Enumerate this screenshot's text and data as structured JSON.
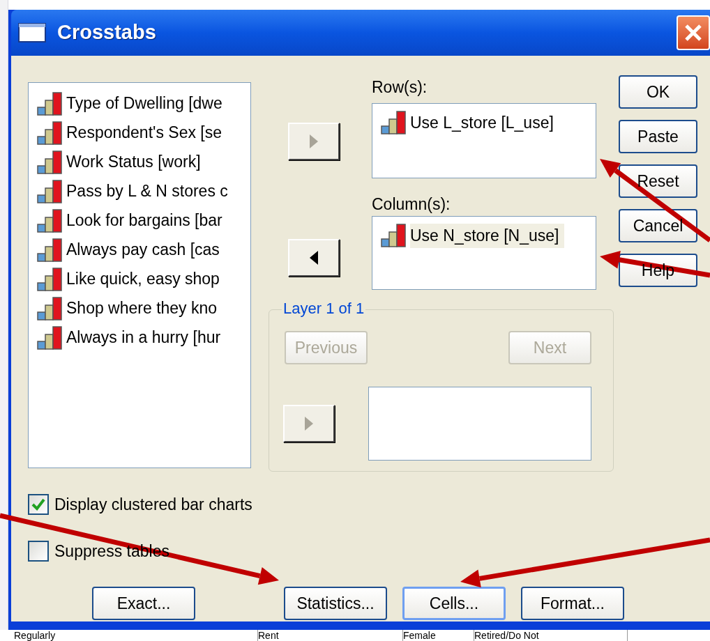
{
  "window": {
    "title": "Crosstabs"
  },
  "variables": [
    {
      "label": "Type of Dwelling [dwe"
    },
    {
      "label": "Respondent's Sex [se"
    },
    {
      "label": "Work Status [work]"
    },
    {
      "label": "Pass by L & N stores c"
    },
    {
      "label": "Look for bargains [bar"
    },
    {
      "label": "Always pay cash [cas"
    },
    {
      "label": "Like quick, easy shop"
    },
    {
      "label": "Shop where they kno"
    },
    {
      "label": "Always in a hurry [hur"
    }
  ],
  "rows": {
    "label": "Row(s):",
    "move_button": {
      "kind": "right",
      "disabled": true
    },
    "items": [
      {
        "label": "Use L_store [L_use]",
        "selected": false
      }
    ]
  },
  "columns": {
    "label": "Column(s):",
    "move_button": {
      "kind": "left",
      "disabled": false
    },
    "items": [
      {
        "label": "Use N_store [N_use]",
        "selected": true
      }
    ]
  },
  "layer": {
    "title": "Layer 1 of 1",
    "previous": {
      "label": "Previous",
      "disabled": true
    },
    "next": {
      "label": "Next",
      "disabled": true
    },
    "move_button": {
      "kind": "right",
      "disabled": true
    }
  },
  "side_buttons": [
    {
      "label": "OK"
    },
    {
      "label": "Paste"
    },
    {
      "label": "Reset"
    },
    {
      "label": "Cancel"
    },
    {
      "label": "Help"
    }
  ],
  "options": [
    {
      "label": "Display clustered bar charts",
      "checked": true
    },
    {
      "label": "Suppress tables",
      "checked": false
    }
  ],
  "bottom_buttons": [
    {
      "label": "Exact...",
      "focused": false
    },
    {
      "label": "Statistics...",
      "focused": false
    },
    {
      "label": "Cells...",
      "focused": true
    },
    {
      "label": "Format...",
      "focused": false
    }
  ],
  "background_row": [
    "Regularly",
    "Rent",
    "Female",
    "Retired/Do Not"
  ]
}
